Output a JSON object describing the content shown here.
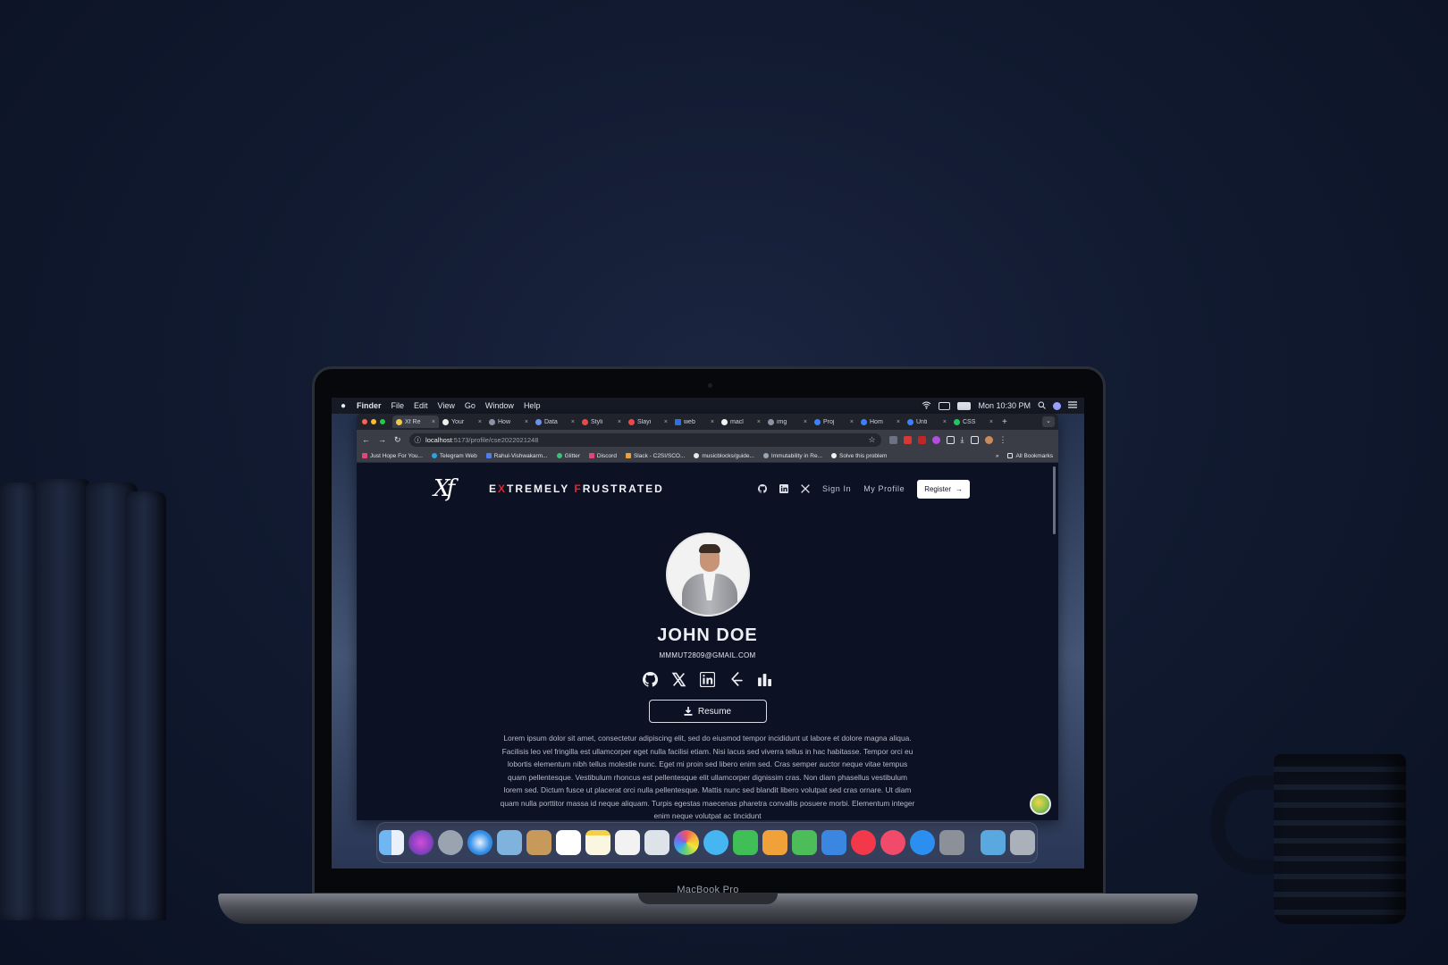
{
  "device": {
    "model_label": "MacBook Pro"
  },
  "menubar": {
    "app_name": "Finder",
    "items": [
      "File",
      "Edit",
      "View",
      "Go",
      "Window",
      "Help"
    ],
    "clock": "Mon 10:30 PM"
  },
  "browser": {
    "tabs": [
      {
        "label": "Xf Re",
        "active": true
      },
      {
        "label": "Your"
      },
      {
        "label": "How"
      },
      {
        "label": "Data"
      },
      {
        "label": "Styli"
      },
      {
        "label": "Slayi"
      },
      {
        "label": "web"
      },
      {
        "label": "macl"
      },
      {
        "label": "img"
      },
      {
        "label": "Proj"
      },
      {
        "label": "Hom"
      },
      {
        "label": "Unti"
      },
      {
        "label": "CSS"
      }
    ],
    "url": {
      "host": "localhost",
      "path": ":5173/profile/cse2022021248"
    },
    "bookmarks": [
      "Just Hope For You...",
      "Telegram Web",
      "Rahul-Vishwakarm...",
      "Glitter",
      "Discord",
      "Slack - C2SI/SCO...",
      "musicblocks/guide...",
      "Immutability in Re...",
      "Solve this problem"
    ],
    "bookmarks_overflow": "»",
    "all_bookmarks": "All Bookmarks"
  },
  "site": {
    "logo_text": "Xf",
    "brand": {
      "e": "E",
      "xtremely": "XTREMELY ",
      "x": "X",
      "f": "F",
      "rustrated": "RUSTRATED"
    },
    "nav": {
      "sign_in": "Sign In",
      "my_profile": "My Profile",
      "register": "Register",
      "register_arrow": "→"
    },
    "profile": {
      "name": "JOHN DOE",
      "email": "MMMUT2809@GMAIL.COM",
      "social_icons": [
        "github-icon",
        "x-twitter-icon",
        "linkedin-icon",
        "leetcode-icon",
        "codeforces-icon"
      ],
      "resume_label": "Resume",
      "bio": "Lorem ipsum dolor sit amet, consectetur adipiscing elit, sed do eiusmod tempor incididunt ut labore et dolore magna aliqua. Facilisis leo vel fringilla est ullamcorper eget nulla facilisi etiam. Nisi lacus sed viverra tellus in hac habitasse. Tempor orci eu lobortis elementum nibh tellus molestie nunc. Eget mi proin sed libero enim sed. Cras semper auctor neque vitae tempus quam pellentesque. Vestibulum rhoncus est pellentesque elit ullamcorper dignissim cras. Non diam phasellus vestibulum lorem sed. Dictum fusce ut placerat orci nulla pellentesque. Mattis nunc sed blandit libero volutpat sed cras ornare. Ut diam quam nulla porttitor massa id neque aliquam. Turpis egestas maecenas pharetra convallis posuere morbi. Elementum integer enim neque volutpat ac tincidunt"
    }
  },
  "colors": {
    "accent_red": "#e0262c",
    "page_bg": "#0c1124"
  }
}
